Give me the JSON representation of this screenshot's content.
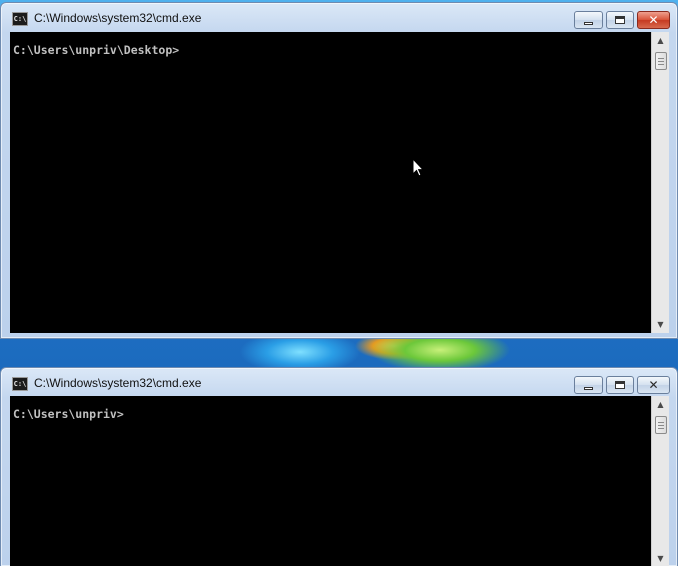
{
  "windows": [
    {
      "title": "C:\\Windows\\system32\\cmd.exe",
      "icon": "cmd-icon",
      "console_text": "C:\\Users\\unpriv\\Desktop>",
      "active": true
    },
    {
      "title": "C:\\Windows\\system32\\cmd.exe",
      "icon": "cmd-icon",
      "console_text": "C:\\Users\\unpriv>",
      "active": false
    }
  ],
  "icons": {
    "app": "C:\\",
    "minimize": "minimize-icon",
    "maximize": "maximize-icon",
    "close": "close-icon",
    "close_glyph": "✕",
    "scroll_up": "▲",
    "scroll_down": "▼"
  },
  "colors": {
    "console_bg": "#000000",
    "console_fg": "#c0c0c0",
    "close_active": "#c53a22"
  }
}
